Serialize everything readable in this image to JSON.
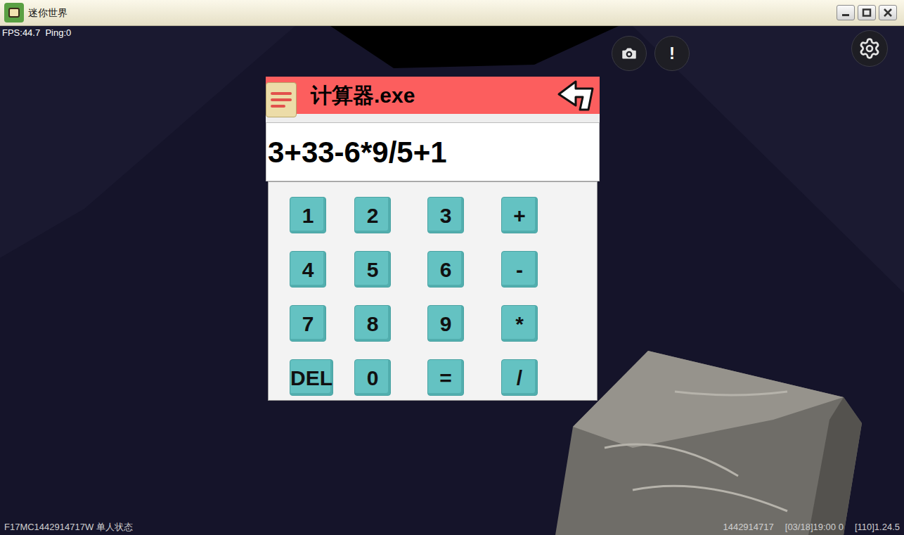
{
  "window": {
    "title": "迷你世界"
  },
  "hud": {
    "stats": "FPS:44.7  Ping:0",
    "alert_button": "!"
  },
  "calculator": {
    "title": "计算器.exe",
    "display": "3+33-6*9/5+1",
    "keys": [
      "1",
      "2",
      "3",
      "+",
      "4",
      "5",
      "6",
      "-",
      "7",
      "8",
      "9",
      "*",
      "DEL",
      "0",
      "=",
      "/"
    ]
  },
  "status_bar": {
    "left": "F17MC1442914717W 单人状态",
    "right": [
      "1442914717",
      "[03/18]19:00 0",
      "[110]1.24.5"
    ]
  }
}
